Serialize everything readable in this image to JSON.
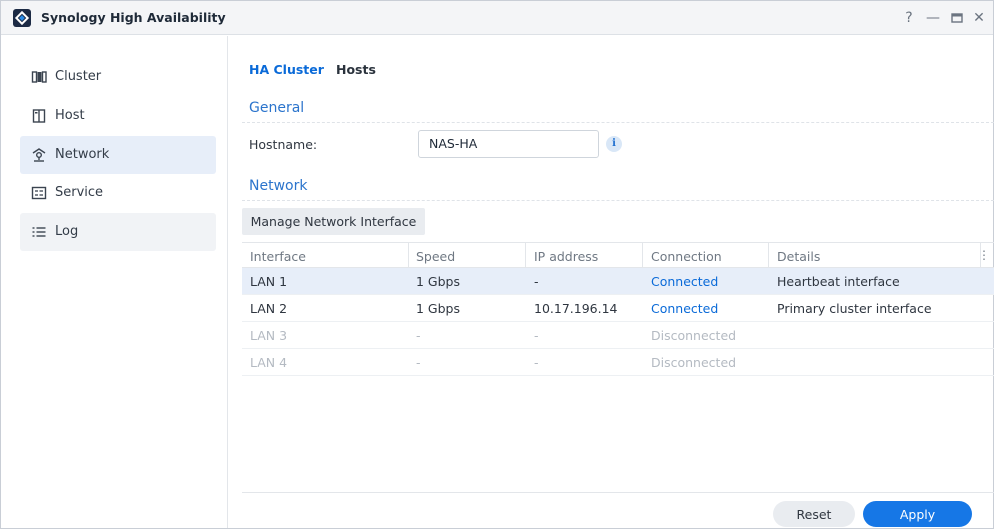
{
  "window": {
    "title": "Synology High Availability",
    "controls": {
      "help": "?",
      "minimize": "—",
      "maximize": "▭",
      "close": "✕"
    }
  },
  "sidebar": {
    "items": [
      {
        "label": "Cluster",
        "icon": "cluster-icon"
      },
      {
        "label": "Host",
        "icon": "host-icon"
      },
      {
        "label": "Network",
        "icon": "network-icon"
      },
      {
        "label": "Service",
        "icon": "service-icon"
      },
      {
        "label": "Log",
        "icon": "log-icon"
      }
    ],
    "active": "Network"
  },
  "tabs": [
    {
      "label": "HA Cluster",
      "active": true
    },
    {
      "label": "Hosts",
      "active": false
    }
  ],
  "general": {
    "section_title": "General",
    "hostname_label": "Hostname:",
    "hostname_value": "NAS-HA",
    "info_icon": "i"
  },
  "network": {
    "section_title": "Network",
    "manage_button": "Manage Network Interface",
    "columns": [
      "Interface",
      "Speed",
      "IP address",
      "Connection",
      "Details"
    ],
    "more_icon": "⋮",
    "rows": [
      {
        "interface": "LAN 1",
        "speed": "1 Gbps",
        "ip": "-",
        "connection": "Connected",
        "details": "Heartbeat interface",
        "selected": true
      },
      {
        "interface": "LAN 2",
        "speed": "1 Gbps",
        "ip": "10.17.196.14",
        "connection": "Connected",
        "details": "Primary cluster interface",
        "selected": false
      },
      {
        "interface": "LAN 3",
        "speed": "-",
        "ip": "-",
        "connection": "Disconnected",
        "details": "",
        "selected": false
      },
      {
        "interface": "LAN 4",
        "speed": "-",
        "ip": "-",
        "connection": "Disconnected",
        "details": "",
        "selected": false
      }
    ]
  },
  "footer": {
    "reset_label": "Reset",
    "apply_label": "Apply"
  },
  "colors": {
    "accent": "#1677e6",
    "link": "#0a6ad8",
    "selected_row": "#e7eef9",
    "section_title": "#2b74cc"
  }
}
